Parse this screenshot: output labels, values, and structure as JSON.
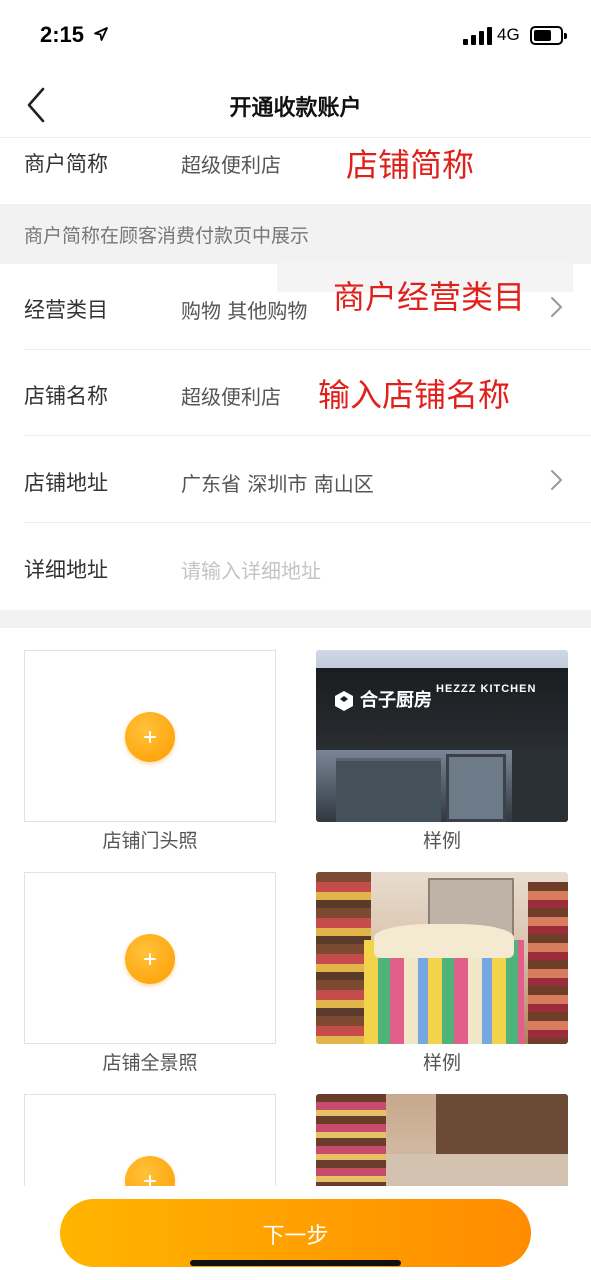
{
  "status_bar": {
    "time": "2:15",
    "network": "4G"
  },
  "nav": {
    "title": "开通收款账户"
  },
  "form": {
    "merchant_short_name": {
      "label": "商户简称",
      "value": "超级便利店"
    },
    "hint": "商户简称在顾客消费付款页中展示",
    "category": {
      "label": "经营类目",
      "value": "购物 其他购物"
    },
    "shop_name": {
      "label": "店铺名称",
      "value": "超级便利店"
    },
    "shop_address": {
      "label": "店铺地址",
      "value": "广东省 深圳市 南山区"
    },
    "detail_address": {
      "label": "详细地址",
      "placeholder": "请输入详细地址"
    }
  },
  "annotations": {
    "shop_short": "店铺简称",
    "category": "商户经营类目",
    "shop_name": "输入店铺名称"
  },
  "photos": {
    "storefront_caption": "店铺门头照",
    "panorama_caption": "店铺全景照",
    "sample_caption": "样例",
    "sample_sign_text": "合子厨房",
    "sample_sign_en": "HEZZZ KITCHEN"
  },
  "actions": {
    "next_label": "下一步"
  },
  "colors": {
    "accent": "#ff9c00",
    "annotation": "#e0201a"
  }
}
